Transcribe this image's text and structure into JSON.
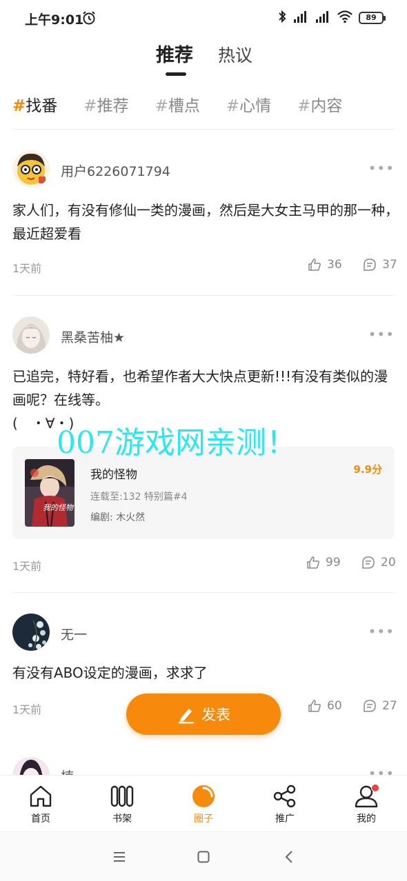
{
  "status_bar": {
    "time": "上午9:01",
    "battery": "89"
  },
  "top_tabs": {
    "active": "推荐",
    "inactive": "热议"
  },
  "topics": [
    {
      "hash": "#",
      "label": "找番"
    },
    {
      "hash": "#",
      "label": "推荐"
    },
    {
      "hash": "#",
      "label": "槽点"
    },
    {
      "hash": "#",
      "label": "心情"
    },
    {
      "hash": "#",
      "label": "内容"
    }
  ],
  "posts": [
    {
      "username": "用户6226071794",
      "more": "•••",
      "content": "家人们，有没有修仙一类的漫画，然后是大女主马甲的那一种，最近超爱看",
      "time": "1天前",
      "likes": "36",
      "comments": "37"
    },
    {
      "username": "黑桑苦柚★",
      "more": "•••",
      "content": "已追完，特好看，也希望作者大大快点更新!!!有没有类似的漫画呢？在线等。",
      "emoticon": "(　・∀・)",
      "comic": {
        "title": "我的怪物",
        "chapter": "连载至:132 特别篇#4",
        "author": "编剧: 木火然",
        "score": "9.9分",
        "cover_text": "我的怪物"
      },
      "time": "1天前",
      "likes": "99",
      "comments": "20"
    },
    {
      "username": "无一",
      "more": "•••",
      "content": "有没有ABO设定的漫画，求求了",
      "time": "1天前",
      "likes": "60",
      "comments": "27"
    },
    {
      "username": "楠",
      "more": "•••"
    }
  ],
  "watermark": "007游戏网亲测！",
  "publish_button": {
    "label": "发表"
  },
  "bottom_nav": [
    {
      "label": "首页",
      "icon": "home-icon"
    },
    {
      "label": "书架",
      "icon": "bookshelf-icon"
    },
    {
      "label": "圈子",
      "icon": "circle-icon"
    },
    {
      "label": "推广",
      "icon": "share-icon"
    },
    {
      "label": "我的",
      "icon": "profile-icon"
    }
  ],
  "colors": {
    "accent": "#f7890c",
    "watermark": "#2ee6f0",
    "badge": "#f04040"
  }
}
